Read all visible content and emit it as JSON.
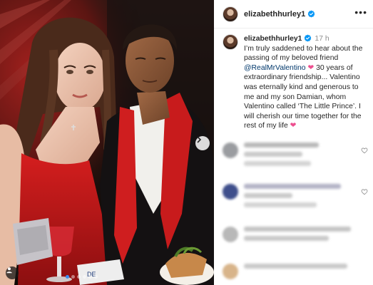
{
  "post": {
    "author": "elizabethhurley1",
    "caption": {
      "time": "17 h",
      "text_before": "I’m truly saddened to hear about the passing of my beloved friend",
      "mention": "@RealMrValentino",
      "text_after": "30 years of extraordinary friendship... Valentino was eternally kind and generous to me and my son Damian, whom Valentino called ‘The Little Prince’. I will cherish our time together for the rest of my life",
      "emoji": "❤"
    },
    "more_label": "•••",
    "carousel": {
      "dots": 6,
      "active_index": 0
    }
  },
  "colors": {
    "verified": "#0095f6",
    "mention": "#00376b",
    "heart": "#ed4f8f",
    "carousel_active": "#3b8df0"
  },
  "icons": [
    "verified-badge-icon",
    "more-options-icon",
    "next-arrow-icon",
    "tagged-user-icon",
    "like-heart-icon"
  ]
}
